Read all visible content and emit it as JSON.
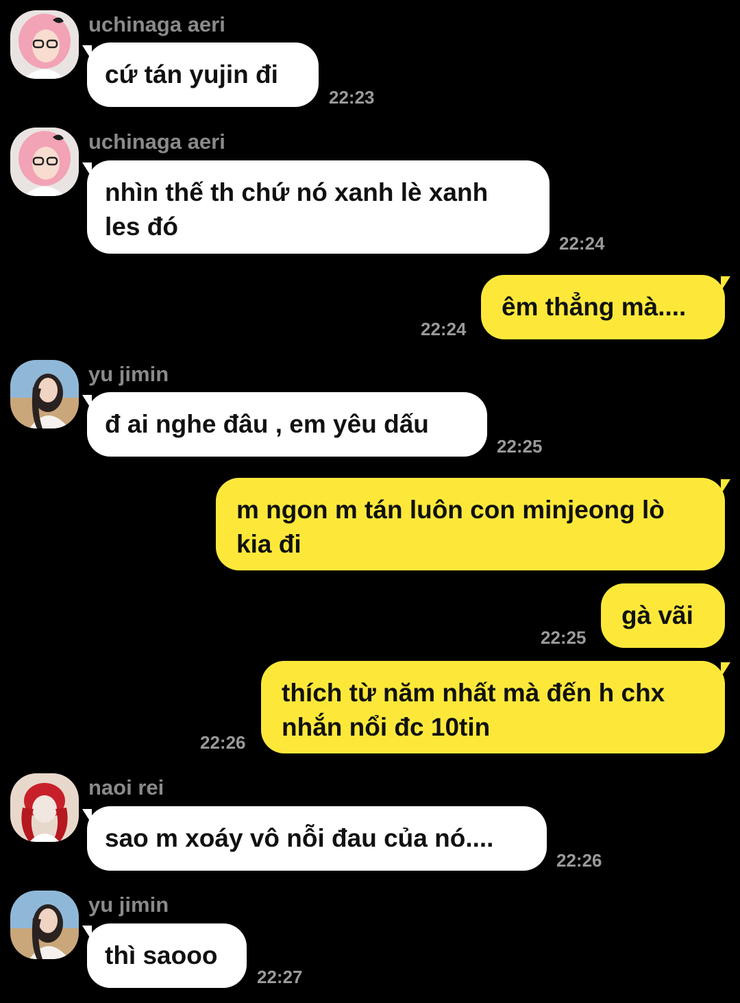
{
  "colors": {
    "background": "#000000",
    "incoming_bubble": "#ffffff",
    "outgoing_bubble": "#fde83a",
    "sender_name": "#8a8a8a",
    "timestamp": "#9a9a9a"
  },
  "messages": [
    {
      "direction": "incoming",
      "sender": "uchinaga aeri",
      "avatar": "avatar-aeri",
      "text": "cứ tán yujin đi",
      "time": "22:23"
    },
    {
      "direction": "incoming",
      "sender": "uchinaga aeri",
      "avatar": "avatar-aeri",
      "text": "nhìn thế th chứ nó xanh lè xanh\nles đó",
      "time": "22:24"
    },
    {
      "direction": "outgoing",
      "text": "êm thẳng mà....",
      "time": "22:24"
    },
    {
      "direction": "incoming",
      "sender": "yu jimin",
      "avatar": "avatar-jimin",
      "text": "đ ai nghe đâu , em yêu dấu",
      "time": "22:25"
    },
    {
      "direction": "outgoing",
      "text": "m ngon m tán luôn con minjeong lò\nkia đi",
      "time": ""
    },
    {
      "direction": "outgoing",
      "text": "gà vãi",
      "time": "22:25"
    },
    {
      "direction": "outgoing",
      "text": "thích từ năm nhất mà đến h chx\nnhắn nổi đc 10tin",
      "time": "22:26"
    },
    {
      "direction": "incoming",
      "sender": "naoi rei",
      "avatar": "avatar-rei",
      "text": "sao m xoáy vô nỗi đau của nó....",
      "time": "22:26"
    },
    {
      "direction": "incoming",
      "sender": "yu jimin",
      "avatar": "avatar-jimin",
      "text": "thì saooo",
      "time": "22:27"
    }
  ]
}
